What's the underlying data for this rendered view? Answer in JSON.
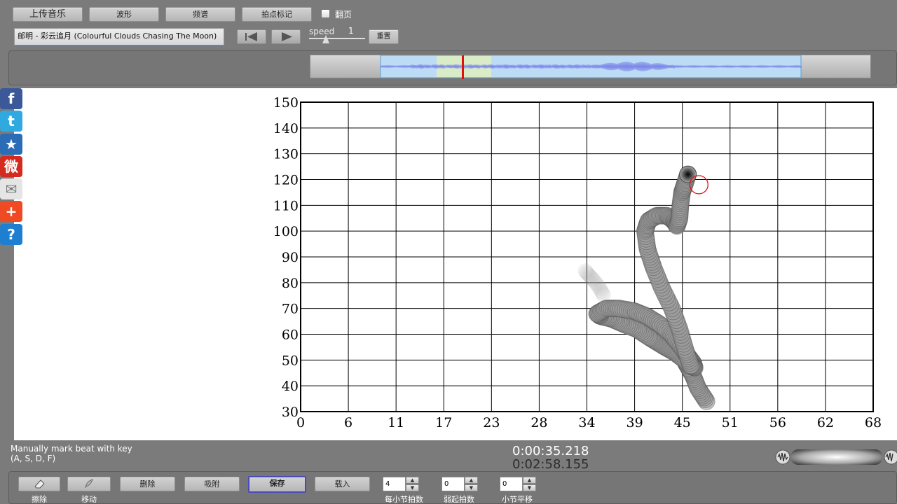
{
  "toolbar": {
    "upload_label": "上传音乐",
    "waveform_label": "波形",
    "spectrum_label": "频谱",
    "beat_mark_label": "拍点标记",
    "flip_label": "翻页",
    "reset_label": "重置"
  },
  "track": {
    "title": "邮明 - 彩云追月 (Colourful Clouds Chasing The Moon)"
  },
  "speed": {
    "label": "speed",
    "value": "1",
    "level": 0.3
  },
  "chart_data": {
    "type": "line",
    "ylim": [
      30,
      150
    ],
    "yticks": [
      "150",
      "140",
      "130",
      "120",
      "110",
      "100",
      "90",
      "80",
      "70",
      "60",
      "50",
      "40",
      "30"
    ],
    "xticks": [
      "0",
      "6",
      "11",
      "17",
      "23",
      "28",
      "34",
      "39",
      "45",
      "51",
      "56",
      "62",
      "68"
    ],
    "series": [
      {
        "x": [
          48.2,
          47.2,
          46.6,
          45.9,
          45.6,
          44.4,
          43.3,
          42.3,
          41.3,
          39.9,
          38.3,
          36.9,
          35.6,
          35.2,
          36.3,
          37.8,
          39.6,
          41.1,
          42.6,
          44.0,
          45.0,
          45.9,
          46.6,
          46.8,
          46.3,
          45.7,
          45.0,
          44.1,
          42.9,
          41.9,
          41.2,
          40.9,
          41.3,
          42.3,
          43.5,
          44.3,
          44.7,
          45.0,
          45.1,
          45.3,
          45.6,
          46.0
        ],
        "y": [
          34,
          39,
          44,
          48,
          50,
          53,
          55,
          57,
          59,
          62,
          64,
          66,
          67,
          68,
          70,
          70,
          69,
          67,
          64,
          60,
          56,
          52,
          49,
          47,
          48,
          54,
          62,
          70,
          78,
          86,
          93,
          100,
          104,
          106,
          106,
          104,
          102,
          105,
          110,
          115,
          118,
          122
        ]
      }
    ],
    "ghost_trail": {
      "x": [
        36.0,
        35.5,
        34.8,
        34.2,
        33.7
      ],
      "y": [
        75,
        78,
        81,
        83,
        85
      ]
    },
    "cursor": {
      "x": 47.3,
      "y": 118
    }
  },
  "status": {
    "hint_line1": "Manually mark beat with key",
    "hint_line2": "(A, S, D, F)",
    "time_current": "0:00:35.218",
    "time_total": "0:02:58.155"
  },
  "tools": {
    "erase_label": "擦除",
    "move_label": "移动",
    "delete_label": "删除",
    "snap_label": "吸附",
    "save_label": "保存",
    "load_label": "载入",
    "beats_per_bar_label": "每小节拍数",
    "beats_per_bar_value": "4",
    "upbeat_label": "弱起拍数",
    "upbeat_value": "0",
    "bar_offset_label": "小节平移",
    "bar_offset_value": "0"
  },
  "social": [
    {
      "icon": "facebook-icon",
      "glyph": "f",
      "color": "#3b5998"
    },
    {
      "icon": "twitter-icon",
      "glyph": "t",
      "color": "#2fa9e0"
    },
    {
      "icon": "favorite-star-icon",
      "glyph": "★",
      "color": "#2a6db6"
    },
    {
      "icon": "weibo-icon",
      "glyph": "微",
      "color": "#d52b1e"
    },
    {
      "icon": "mail-icon",
      "glyph": "✉",
      "color": "#e5e5e5"
    },
    {
      "icon": "add-share-icon",
      "glyph": "+",
      "color": "#ef4a24"
    },
    {
      "icon": "help-icon",
      "glyph": "?",
      "color": "#1e7fd0"
    }
  ],
  "colors": {
    "waveform": "#7b85e8",
    "selection": "#bcdcf6",
    "window": "#d9ecc7",
    "playhead": "#e01010",
    "cursor_ring": "#e01010",
    "grid": "#000000"
  }
}
